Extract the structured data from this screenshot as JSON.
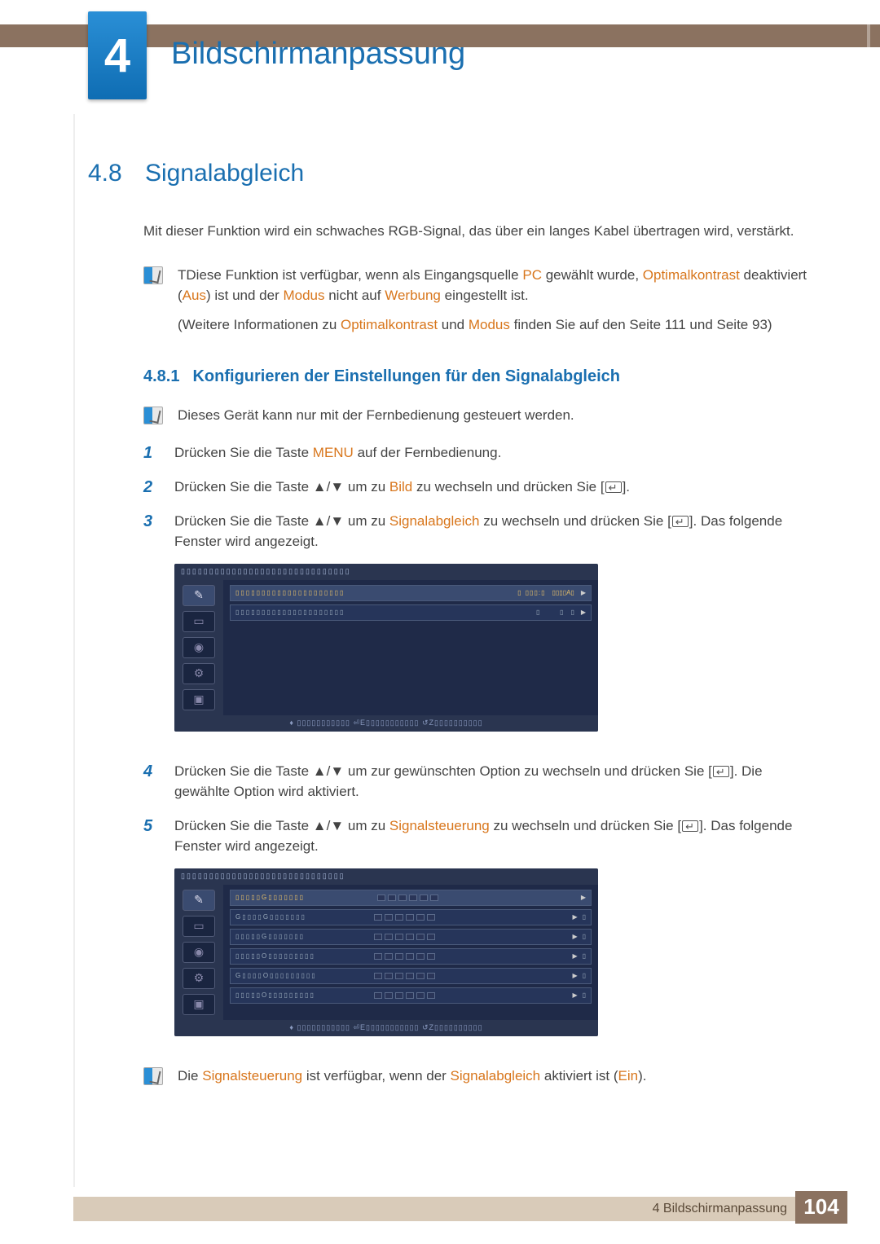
{
  "chapter": {
    "number": "4",
    "title": "Bildschirmanpassung"
  },
  "section": {
    "number": "4.8",
    "title": "Signalabgleich"
  },
  "intro": "Mit dieser Funktion wird ein schwaches RGB-Signal, das über ein langes Kabel übertragen wird, verstärkt.",
  "note1": {
    "p1a": "TDiese Funktion ist verfügbar, wenn als Eingangsquelle ",
    "pc": "PC",
    "p1b": " gewählt wurde, ",
    "optk": "Optimalkontrast",
    "p1c": " deaktiviert (",
    "aus": "Aus",
    "p1d": ") ist und der ",
    "modus": "Modus",
    "p1e": " nicht auf ",
    "werbung": "Werbung",
    "p1f": " eingestellt ist.",
    "p2a": "(Weitere Informationen zu ",
    "p2b": " und ",
    "p2c": " finden Sie auf den Seite 111 und Seite 93)"
  },
  "subsection": {
    "number": "4.8.1",
    "title": "Konfigurieren der Einstellungen für den Signalabgleich"
  },
  "note2": "Dieses Gerät kann nur mit der Fernbedienung gesteuert werden.",
  "steps": {
    "s1a": "Drücken Sie die Taste ",
    "menu": "MENU",
    "s1b": " auf der Fernbedienung.",
    "s2a": "Drücken Sie die Taste ▲/▼ um zu ",
    "bild": "Bild",
    "s2b": " zu wechseln und drücken Sie [",
    "s2c": "].",
    "s3a": "Drücken Sie die Taste ▲/▼ um zu ",
    "sig": "Signalabgleich",
    "s3b": " zu wechseln und drücken Sie [",
    "s3c": "]. Das folgende Fenster wird angezeigt.",
    "s4a": "Drücken Sie die Taste ▲/▼ um zur gewünschten Option zu wechseln und drücken Sie [",
    "s4b": "]. Die gewählte Option wird aktiviert.",
    "s5a": "Drücken Sie die Taste ▲/▼ um zu ",
    "sigst": "Signalsteuerung",
    "s5b": " zu wechseln und drücken Sie [",
    "s5c": "]. Das folgende Fenster wird angezeigt."
  },
  "osd1": {
    "header": "▯▯▯▯▯▯▯▯▯▯▯▯▯▯▯▯▯▯▯▯▯▯▯▯▯▯▯▯▯▯",
    "rows": [
      {
        "label": "▯▯▯▯▯▯▯▯▯▯▯▯▯▯▯▯▯▯▯▯▯",
        "mid": "▯",
        "val": "▯▯▯:▯",
        "arrow": "▶",
        "right": "▯▯▯▯A▯",
        "active": true
      },
      {
        "label": "▯▯▯▯▯▯▯▯▯▯▯▯▯▯▯▯▯▯▯▯▯",
        "mid": "▯",
        "val": "▯",
        "arrow": "▶",
        "right": "▯",
        "active": false
      }
    ],
    "footer": "♦ ▯▯▯▯▯▯▯▯▯▯▯   ⏎E▯▯▯▯▯▯▯▯▯▯▯   ↺Z▯▯▯▯▯▯▯▯▯▯"
  },
  "osd2": {
    "header": "▯▯▯▯▯▯▯▯▯▯▯▯▯▯▯▯▯▯▯▯▯▯▯▯▯▯▯▯▯",
    "rows": [
      {
        "label": "▯▯▯▯▯G▯▯▯▯▯▯▯",
        "val": "▯",
        "active": true
      },
      {
        "label": "G▯▯▯▯G▯▯▯▯▯▯▯",
        "val": "▯"
      },
      {
        "label": "▯▯▯▯▯G▯▯▯▯▯▯▯",
        "val": "▯"
      },
      {
        "label": "▯▯▯▯▯O▯▯▯▯▯▯▯▯▯",
        "val": "▯"
      },
      {
        "label": "G▯▯▯▯O▯▯▯▯▯▯▯▯▯",
        "val": "▯"
      },
      {
        "label": "▯▯▯▯▯O▯▯▯▯▯▯▯▯▯",
        "val": "▯"
      }
    ],
    "footer": "♦ ▯▯▯▯▯▯▯▯▯▯▯   ⏎E▯▯▯▯▯▯▯▯▯▯▯   ↺Z▯▯▯▯▯▯▯▯▯▯"
  },
  "note3": {
    "a": "Die ",
    "sigst": "Signalsteuerung",
    "b": " ist verfügbar, wenn der ",
    "sig": "Signalabgleich",
    "c": " aktiviert ist (",
    "ein": "Ein",
    "d": ")."
  },
  "footer": {
    "text": "4 Bildschirmanpassung",
    "page": "104"
  }
}
